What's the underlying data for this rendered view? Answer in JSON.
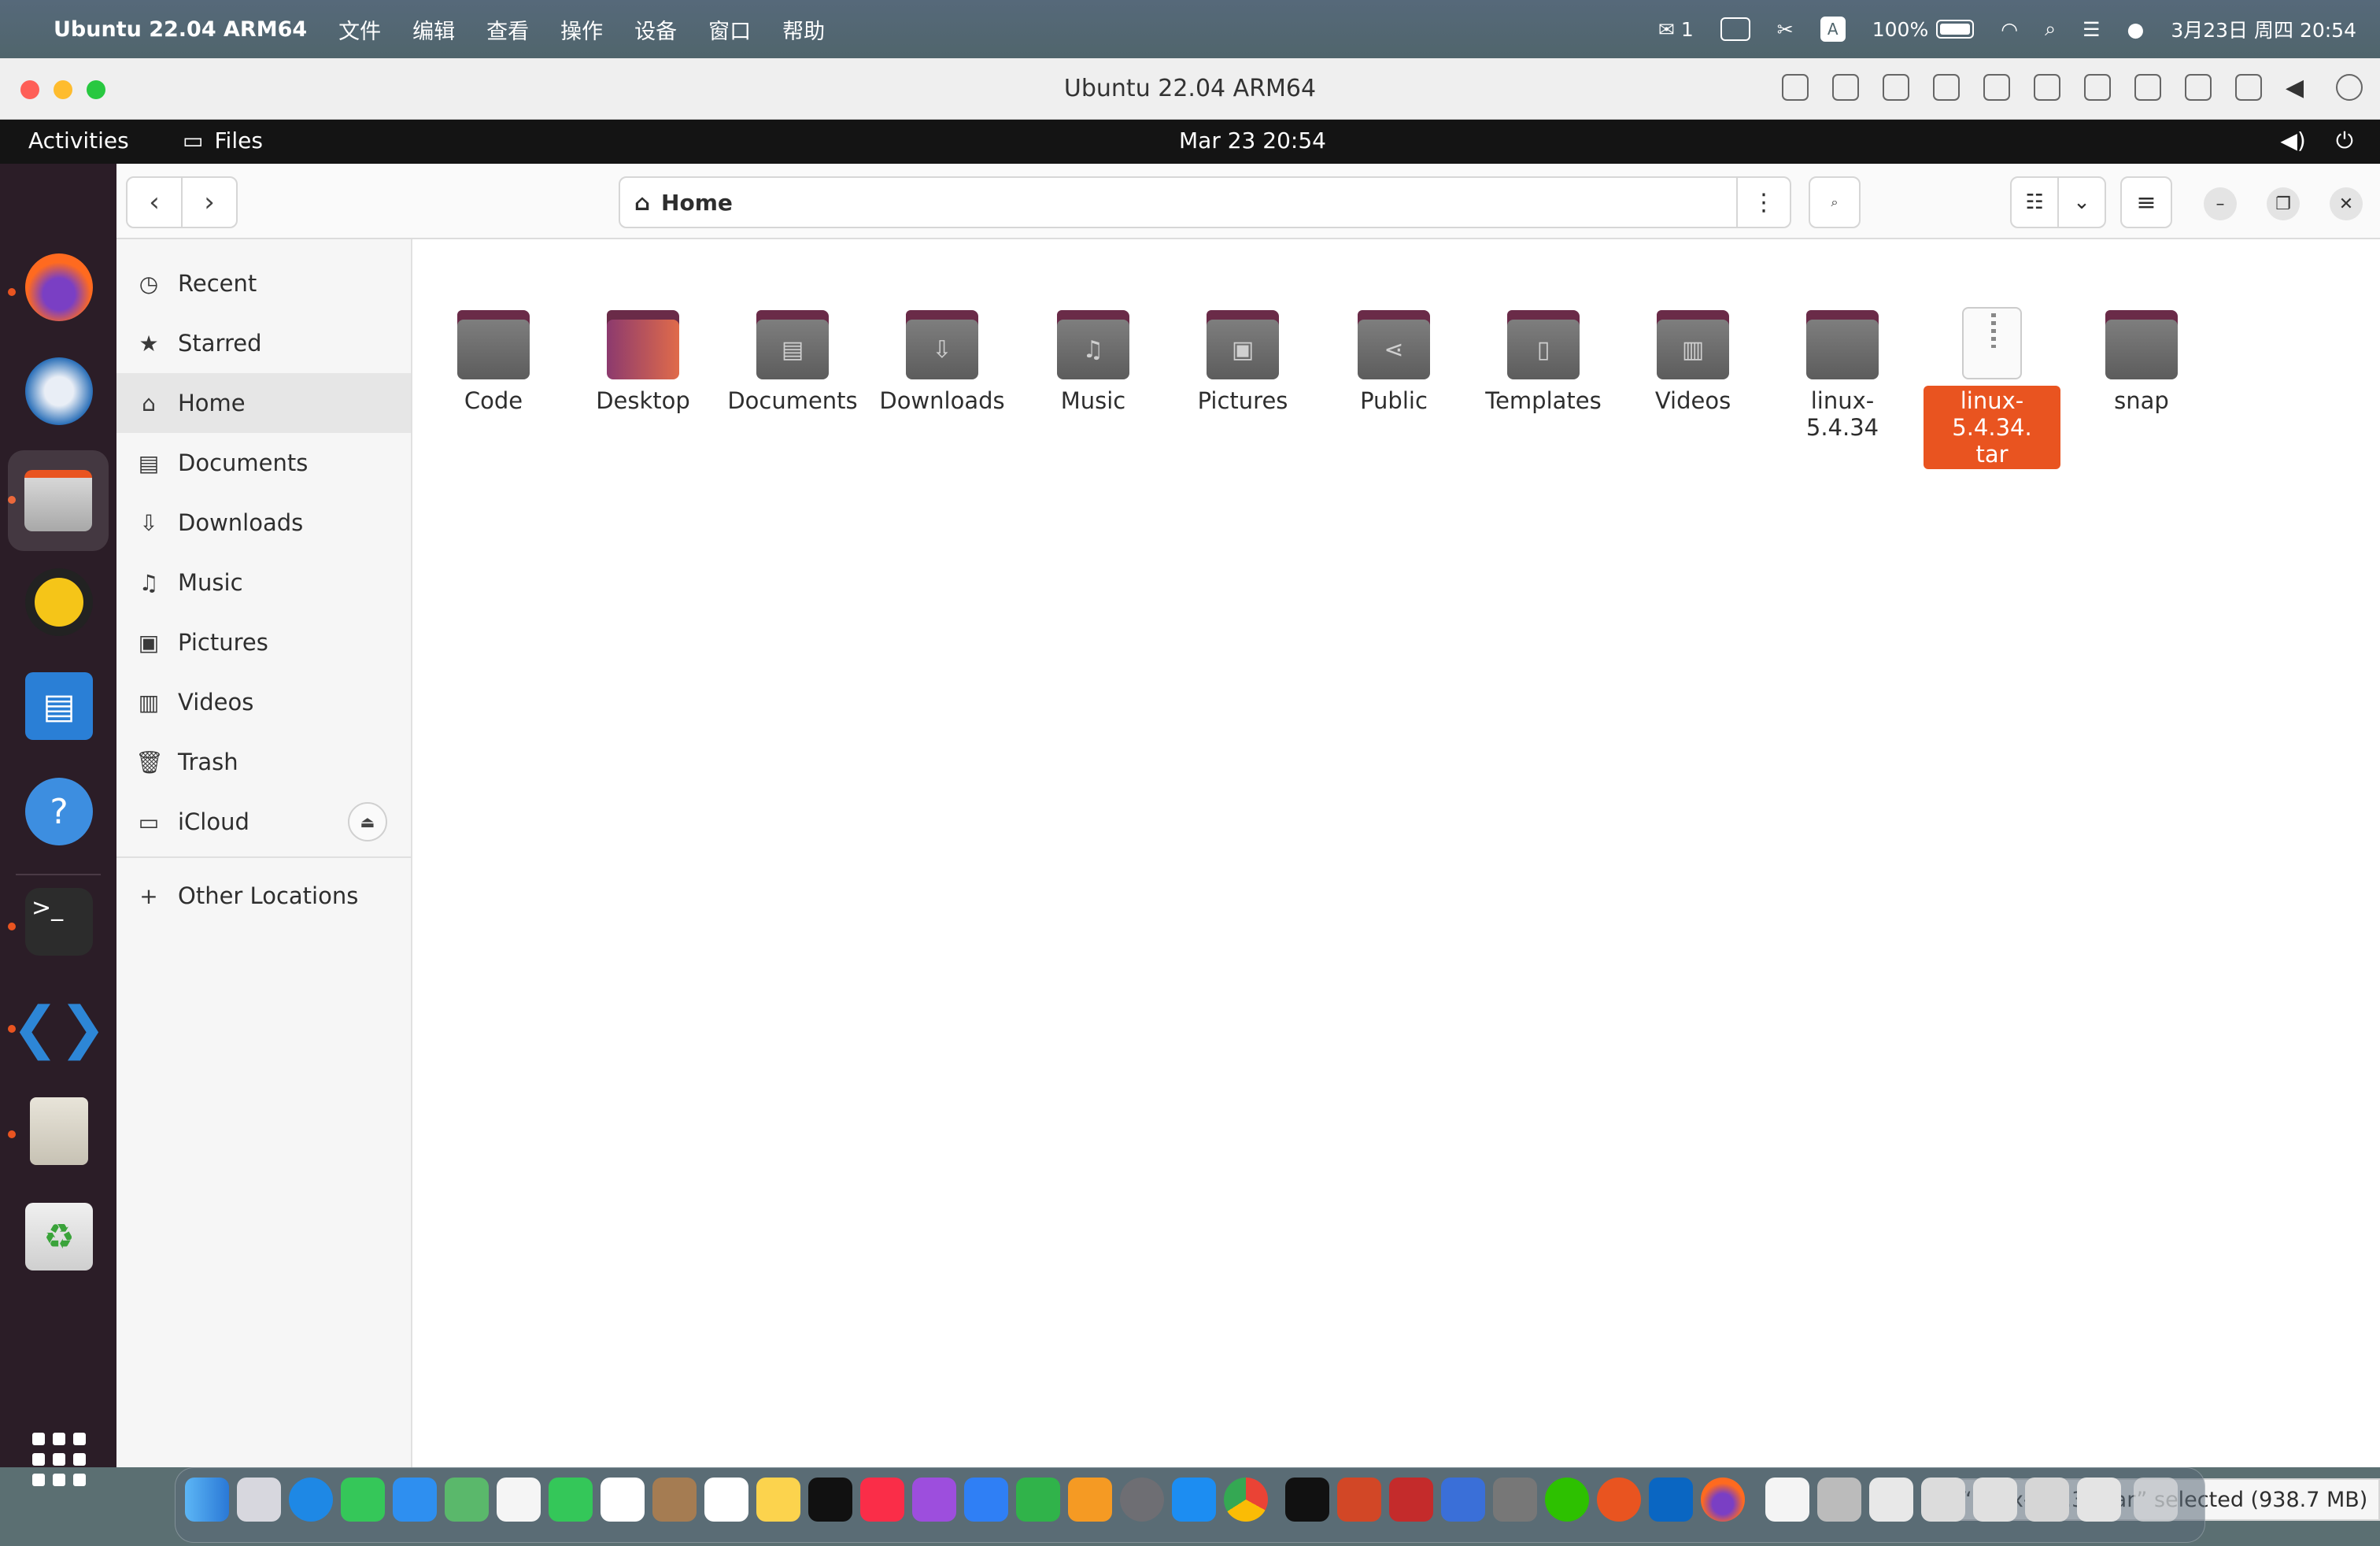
{
  "mac_menubar": {
    "app_name": "Ubuntu 22.04 ARM64",
    "menus": [
      "文件",
      "编辑",
      "查看",
      "操作",
      "设备",
      "窗口",
      "帮助"
    ],
    "wechat_badge": "1",
    "input_method": "A",
    "battery": "100%",
    "datetime": "3月23日 周四 20:54"
  },
  "vm_window": {
    "title": "Ubuntu 22.04 ARM64"
  },
  "ubuntu_topbar": {
    "activities": "Activities",
    "app": "Files",
    "clock": "Mar 23  20:54"
  },
  "files": {
    "path": "Home",
    "sidebar": {
      "items": [
        {
          "label": "Recent",
          "icon": "clock-icon"
        },
        {
          "label": "Starred",
          "icon": "star-icon"
        },
        {
          "label": "Home",
          "icon": "home-icon"
        },
        {
          "label": "Documents",
          "icon": "document-icon"
        },
        {
          "label": "Downloads",
          "icon": "download-icon"
        },
        {
          "label": "Music",
          "icon": "music-icon"
        },
        {
          "label": "Pictures",
          "icon": "picture-icon"
        },
        {
          "label": "Videos",
          "icon": "video-icon"
        },
        {
          "label": "Trash",
          "icon": "trash-icon"
        },
        {
          "label": "iCloud",
          "icon": "drive-icon"
        }
      ],
      "other_locations": "Other Locations"
    },
    "items": [
      {
        "name": "Code"
      },
      {
        "name": "Desktop"
      },
      {
        "name": "Documents"
      },
      {
        "name": "Downloads"
      },
      {
        "name": "Music"
      },
      {
        "name": "Pictures"
      },
      {
        "name": "Public"
      },
      {
        "name": "Templates"
      },
      {
        "name": "Videos"
      },
      {
        "name": "linux-5.4.34"
      },
      {
        "name": "linux-5.4.34.\ntar"
      },
      {
        "name": "snap"
      }
    ],
    "selected_item": "linux-5.4.34.tar",
    "status": "“linux-5.4.34.tar” selected  (938.7 MB)"
  },
  "colors": {
    "accent": "#e95420",
    "dock_bg": "#2b1d27",
    "folder_tab": "#6a2b48"
  }
}
